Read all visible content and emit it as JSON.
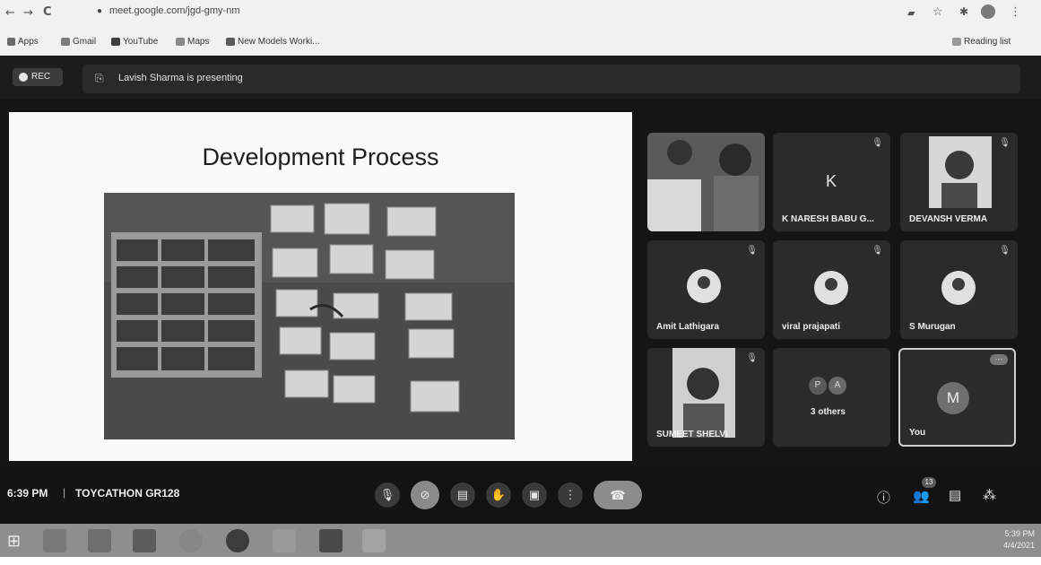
{
  "browser": {
    "url": "meet.google.com/jgd-gmy-nm",
    "bookmarks": [
      "Apps",
      "Gmail",
      "YouTube",
      "Maps",
      "New Models Worki..."
    ],
    "reading_list": "Reading list"
  },
  "meeting": {
    "rec_label": "REC",
    "presenting_text": "Lavish Sharma is presenting",
    "time": "6:39 PM",
    "separator": "|",
    "meeting_name": "TOYCATHON GR128",
    "participants_badge": "13"
  },
  "slide": {
    "title": "Development Process"
  },
  "participants": [
    {
      "name": "",
      "avatar": "video"
    },
    {
      "name": "K NARESH BABU G...",
      "initial": "K"
    },
    {
      "name": "DEVANSH VERMA",
      "avatar": "video"
    },
    {
      "name": "Amit Lathigara",
      "avatar": "photo"
    },
    {
      "name": "viral prajapati",
      "avatar": "photo"
    },
    {
      "name": "S Murugan",
      "avatar": "photo"
    },
    {
      "name": "SUMEET SHELVI",
      "avatar": "video"
    },
    {
      "name": "3 others",
      "initials": [
        "P",
        "A"
      ]
    },
    {
      "name": "You",
      "initial": "M"
    }
  ],
  "taskbar": {
    "time": "5:39 PM",
    "date": "4/4/2021"
  }
}
